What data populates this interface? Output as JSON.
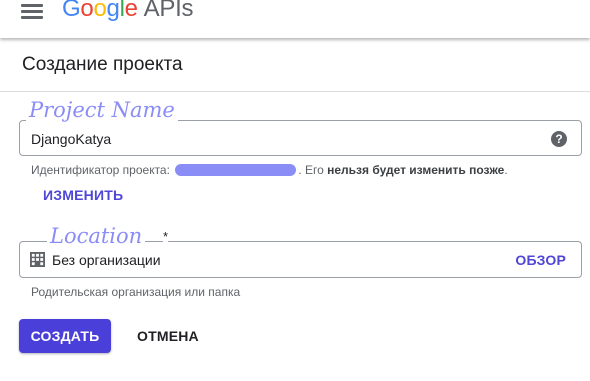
{
  "appbar": {
    "logo_letters": [
      "G",
      "o",
      "o",
      "g",
      "l",
      "e"
    ],
    "logo_colors": [
      "#4285F4",
      "#EA4335",
      "#FBBC05",
      "#4285F4",
      "#34A853",
      "#EA4335"
    ],
    "logo_suffix": "APIs",
    "menu_icon": "hamburger-menu-icon"
  },
  "page": {
    "title": "Создание проекта"
  },
  "project_name": {
    "legend": "Project Name",
    "value": "DjangoKatya",
    "help_icon": "help-circle-icon",
    "help_symbol": "?"
  },
  "project_id": {
    "prefix": "Идентификатор проекта:",
    "mid": ". Его ",
    "bold": "нельзя будет изменить позже",
    "suffix": ".",
    "redaction_color": "#8a8df5",
    "edit_label": "ИЗМЕНИТЬ"
  },
  "location": {
    "legend": "Location",
    "required_mark": "*",
    "value": "Без организации",
    "icon": "building-icon",
    "browse_label": "ОБЗОР",
    "hint": "Родительская организация или папка"
  },
  "actions": {
    "create_label": "СОЗДАТЬ",
    "cancel_label": "ОТМЕНА",
    "primary_color": "#4b3fd9"
  }
}
